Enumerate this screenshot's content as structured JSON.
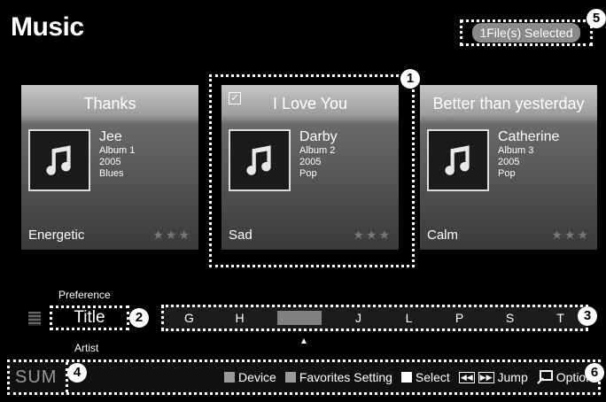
{
  "header": {
    "title": "Music",
    "selected_count": "1File(s) Selected"
  },
  "callouts": [
    "1",
    "2",
    "3",
    "4",
    "5",
    "6"
  ],
  "cards": [
    {
      "title": "Thanks",
      "artist": "Jee",
      "album": "Album 1",
      "year": "2005",
      "genre": "Blues",
      "mood": "Energetic",
      "stars": "★★★",
      "checked": false
    },
    {
      "title": "I Love You",
      "artist": "Darby",
      "album": "Album 2",
      "year": "2005",
      "genre": "Pop",
      "mood": "Sad",
      "stars": "★★★",
      "checked": true
    },
    {
      "title": "Better than yesterday",
      "artist": "Catherine",
      "album": "Album 3",
      "year": "2005",
      "genre": "Pop",
      "mood": "Calm",
      "stars": "★★★",
      "checked": false
    }
  ],
  "sort": {
    "above": "Preference",
    "current": "Title",
    "below": "Artist"
  },
  "letters": [
    "G",
    "H",
    "",
    "J",
    "L",
    "P",
    "S",
    "T"
  ],
  "active_letter_index": 2,
  "bottom": {
    "logo": "SUM",
    "device": "Device",
    "favorites": "Favorites Setting",
    "select": "Select",
    "jump": "Jump",
    "option": "Option"
  },
  "colors": {
    "device_key": "#9a9a9a",
    "favorites_key": "#9a9a9a",
    "select_key": "#ffffff"
  },
  "icons": {
    "music_note": "music-note-icon",
    "checkbox": "check-icon",
    "skip": "skip-arrows-icon",
    "option": "option-icon"
  }
}
